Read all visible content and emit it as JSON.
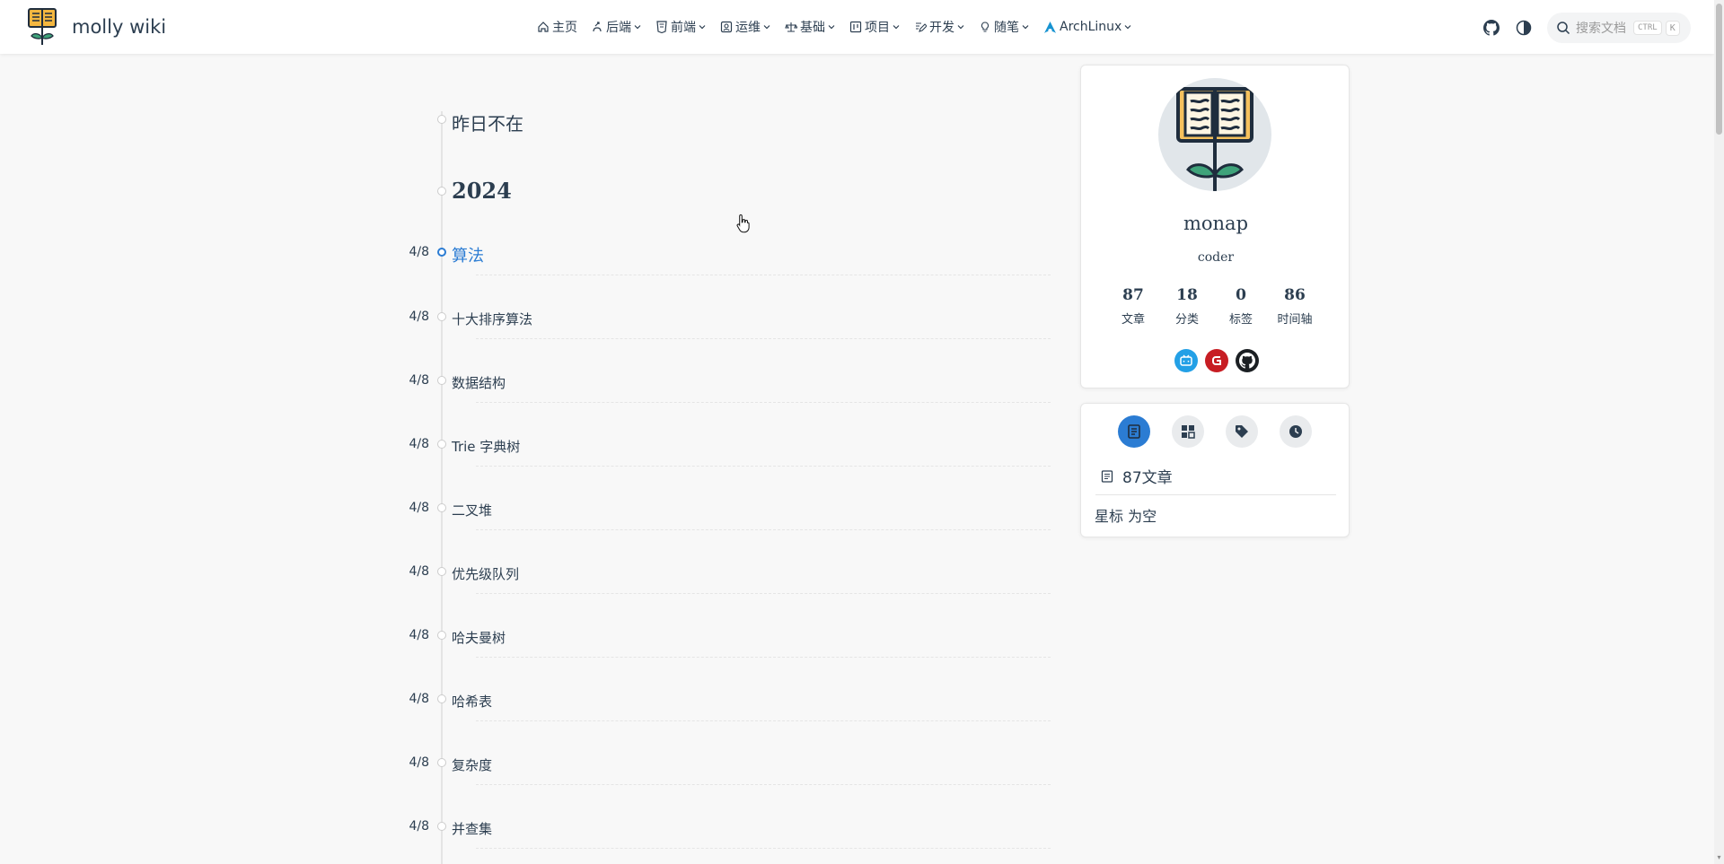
{
  "site": {
    "name": "molly wiki"
  },
  "nav": {
    "items": [
      {
        "label": "主页",
        "icon": "home-icon",
        "dropdown": false
      },
      {
        "label": "后端",
        "icon": "backend-icon",
        "dropdown": true
      },
      {
        "label": "前端",
        "icon": "html5-icon",
        "dropdown": true
      },
      {
        "label": "运维",
        "icon": "ops-icon",
        "dropdown": true
      },
      {
        "label": "基础",
        "icon": "scale-icon",
        "dropdown": true
      },
      {
        "label": "项目",
        "icon": "board-icon",
        "dropdown": true
      },
      {
        "label": "开发",
        "icon": "edit-icon",
        "dropdown": true
      },
      {
        "label": "随笔",
        "icon": "bulb-icon",
        "dropdown": true
      },
      {
        "label": "ArchLinux",
        "icon": "archlinux-icon",
        "dropdown": true
      }
    ],
    "search_placeholder": "搜索文档",
    "kbd_ctrl": "CTRL",
    "kbd_k": "K"
  },
  "timeline": {
    "motto": "昨日不在",
    "year": "2024",
    "entries": [
      {
        "date": "4/8",
        "title": "算法",
        "active": true
      },
      {
        "date": "4/8",
        "title": "十大排序算法"
      },
      {
        "date": "4/8",
        "title": "数据结构"
      },
      {
        "date": "4/8",
        "title": "Trie 字典树"
      },
      {
        "date": "4/8",
        "title": "二叉堆"
      },
      {
        "date": "4/8",
        "title": "优先级队列"
      },
      {
        "date": "4/8",
        "title": "哈夫曼树"
      },
      {
        "date": "4/8",
        "title": "哈希表"
      },
      {
        "date": "4/8",
        "title": "复杂度"
      },
      {
        "date": "4/8",
        "title": "并查集"
      }
    ]
  },
  "profile": {
    "name": "monap",
    "description": "coder",
    "stats": [
      {
        "value": "87",
        "label": "文章"
      },
      {
        "value": "18",
        "label": "分类"
      },
      {
        "value": "0",
        "label": "标签"
      },
      {
        "value": "86",
        "label": "时间轴"
      }
    ],
    "socials": [
      {
        "icon": "bilibili-icon",
        "color": "#23a0e6"
      },
      {
        "icon": "gitee-icon",
        "color": "#c71d23"
      },
      {
        "icon": "github-icon",
        "color": "#1b1f23"
      }
    ]
  },
  "sidebar_tabs": {
    "tabs": [
      "article-icon",
      "category-icon",
      "tag-icon",
      "clock-icon"
    ],
    "articles_count": "87文章",
    "star_empty": "星标 为空"
  },
  "colors": {
    "accent": "#2b7cd3",
    "text": "#2c3e50",
    "background": "#f8f8f8"
  }
}
